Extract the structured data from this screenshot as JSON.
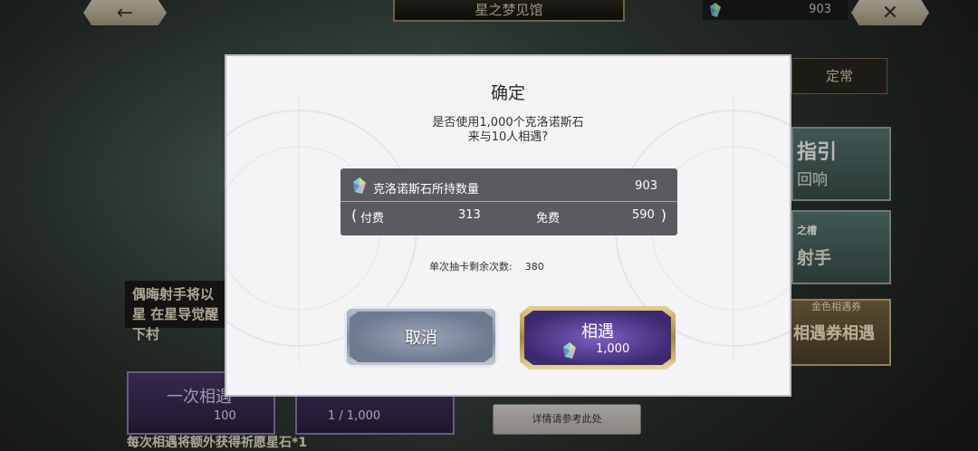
{
  "header": {
    "title": "星之梦见馆",
    "currency_value": "903"
  },
  "background": {
    "tab_regular": "定常",
    "card_guide_title": "指引",
    "card_guide_sub": "回响",
    "card_archer_small": "之槽",
    "card_archer_title": "射手",
    "ticket_small": "金色相遇券",
    "ticket_label": "相遇券相遇",
    "promo_text": "偶晦射手将以星 在星导觉醒下村",
    "once_label": "一次相遇",
    "once_cost": "100",
    "ten_cost": "1 / 1,000",
    "details_label": "详情请参考此处",
    "footer_note": "每次相遇将额外获得祈愿星石*1"
  },
  "modal": {
    "title": "确定",
    "message_line1": "是否使用1,000个克洛诺斯石",
    "message_line2": "来与10人相遇?",
    "stone_label": "克洛诺斯石所持数量",
    "stone_total": "903",
    "paid_label": "付费",
    "paid_value": "313",
    "free_label": "免费",
    "free_value": "590",
    "paren_open": "(",
    "paren_close": ")",
    "remaining_label": "单次抽卡剩余次数:",
    "remaining_value": "380",
    "cancel_label": "取消",
    "confirm_label": "相遇",
    "confirm_cost": "1,000"
  },
  "icons": {
    "back": "arrow-left-icon",
    "close": "close-icon",
    "stone": "chronos-stone-gem-icon"
  },
  "colors": {
    "modal_bg": "#f4f3f5",
    "info_box_bg": "#5b5b5f",
    "confirm_purple": "#3c2a70",
    "confirm_gold": "#c9a85a",
    "cancel_silver": "#8f9ab0"
  }
}
